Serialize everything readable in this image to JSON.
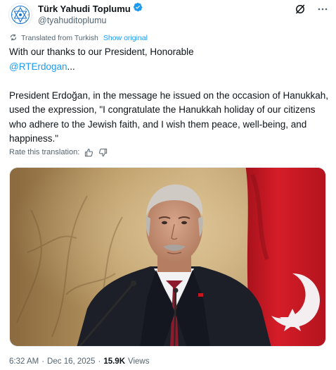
{
  "account": {
    "display_name": "Türk Yahudi Toplumu",
    "handle": "@tyahuditoplumu",
    "verified": true,
    "avatar_icon": "star-of-david-logo",
    "verified_icon": "verified-badge-icon",
    "brand_color": "#1d9bf0"
  },
  "header_actions": {
    "grok_icon": "grok-icon",
    "more_icon": "more-options-icon"
  },
  "translation": {
    "label": "Translated from Turkish",
    "show_original": "Show original",
    "icon": "translate-icon"
  },
  "tweet": {
    "line1": "With our thanks to our President, Honorable",
    "mention": "@RTErdogan",
    "ellipsis": "...",
    "paragraph2": "President Erdoğan, in the message he issued on the occasion of Hanukkah, used the expression, \"I congratulate the Hanukkah holiday of our citizens who adhere to the Jewish faith, and I wish them peace, well-being, and happiness.\""
  },
  "rate": {
    "label": "Rate this translation:",
    "thumbs_up_icon": "thumbs-up-icon",
    "thumbs_down_icon": "thumbs-down-icon"
  },
  "meta": {
    "time": "6:32 AM",
    "separator": "·",
    "date": "Dec 16, 2025",
    "separator2": "·",
    "views_count": "15.9K",
    "views_label": "Views"
  }
}
